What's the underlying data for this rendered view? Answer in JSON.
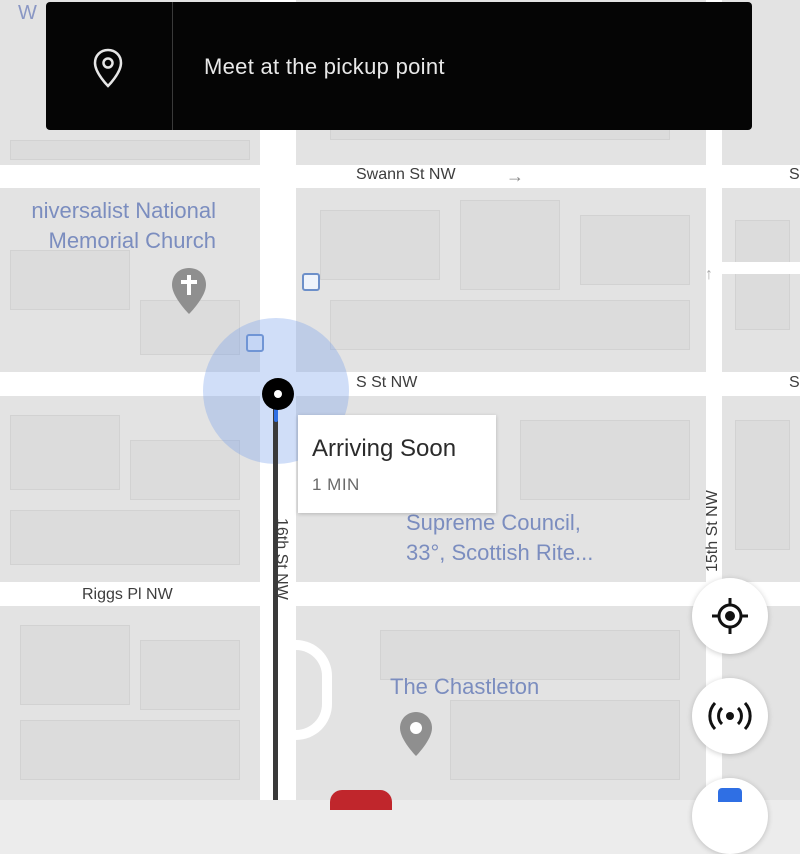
{
  "banner": {
    "icon": "location-pin-icon",
    "message": "Meet at the pickup point"
  },
  "streets": {
    "swann": "Swann St NW",
    "s_st": "S St NW",
    "riggs": "Riggs Pl NW",
    "sixteenth": "16th St NW",
    "fifteenth": "15th St NW",
    "edge_top_left": "W",
    "edge_right_1": "S",
    "edge_right_2": "S"
  },
  "pois": {
    "church_line1": "niversalist National",
    "church_line2": "Memorial Church",
    "council_line1": "Supreme Council,",
    "council_line2": "33°, Scottish Rite...",
    "chastleton": "The Chastleton"
  },
  "eta": {
    "title": "Arriving Soon",
    "subtitle": "1 MIN"
  },
  "controls": {
    "recenter_icon": "crosshair-icon",
    "broadcast_icon": "broadcast-icon"
  },
  "colors": {
    "banner_bg": "#050505",
    "route": "#3a3a3a",
    "accent_blue": "#2f6fe4",
    "poi_text": "#7b8dbf",
    "car": "#c0262c"
  }
}
